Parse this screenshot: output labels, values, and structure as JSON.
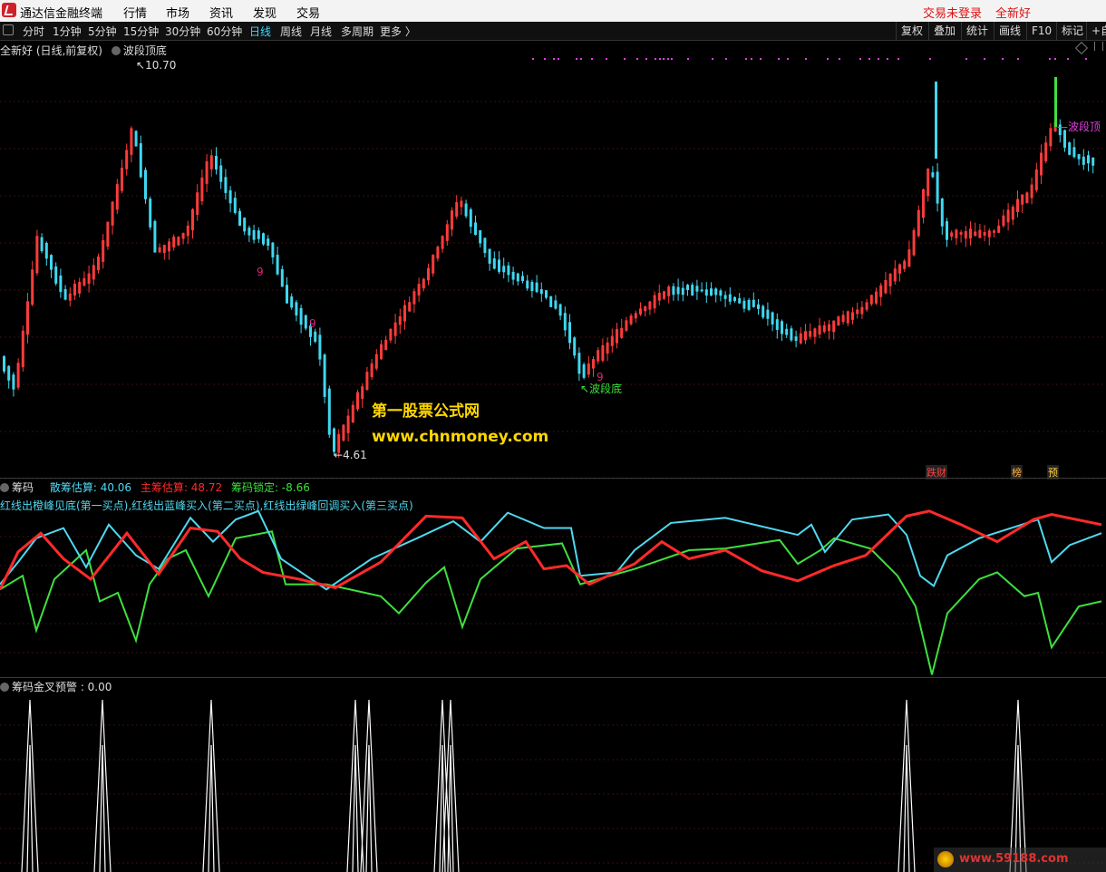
{
  "app": {
    "title": "通达信金融终端",
    "menus": [
      "行情",
      "市场",
      "资讯",
      "发现",
      "交易"
    ],
    "right_links": [
      "交易未登录",
      "全新好"
    ]
  },
  "toolbar": {
    "periods": [
      "分时",
      "1分钟",
      "5分钟",
      "15分钟",
      "30分钟",
      "60分钟",
      "日线",
      "周线",
      "月线",
      "多周期",
      "更多 〉"
    ],
    "active_period": "日线",
    "right_buttons": [
      "复权",
      "叠加",
      "统计",
      "画线",
      "F10",
      "标记",
      "+自"
    ]
  },
  "main_chart": {
    "stock_label": "全新好 (日线,前复权)",
    "indicator": "波段顶底",
    "high_label": "10.70",
    "low_label": "4.61",
    "top_marker": "波段顶",
    "bottom_marker": "波段底",
    "nine_marks": [
      "9",
      "9",
      "9"
    ],
    "badges": [
      "跌财",
      "榜",
      "预"
    ],
    "watermark_line1": "第一股票公式网",
    "watermark_line2": "www.chnmoney.com"
  },
  "chip_panel": {
    "name": "筹码",
    "scatter_label": "散筹估算: 40.06",
    "main_label": "主筹估算: 48.72",
    "lock_label": "筹码锁定: -8.66",
    "desc": "红线出橙峰见底(第一买点),红线出蓝峰买入(第二买点),红线出绿峰回调买入(第三买点)",
    "colors": {
      "scatter": "#4fd8f0",
      "main": "#ff2a2a",
      "lock": "#3ee03e"
    }
  },
  "alert_panel": {
    "label": "筹码金叉预警 : 0.00"
  },
  "corner_watermark": "www.59188.com"
}
